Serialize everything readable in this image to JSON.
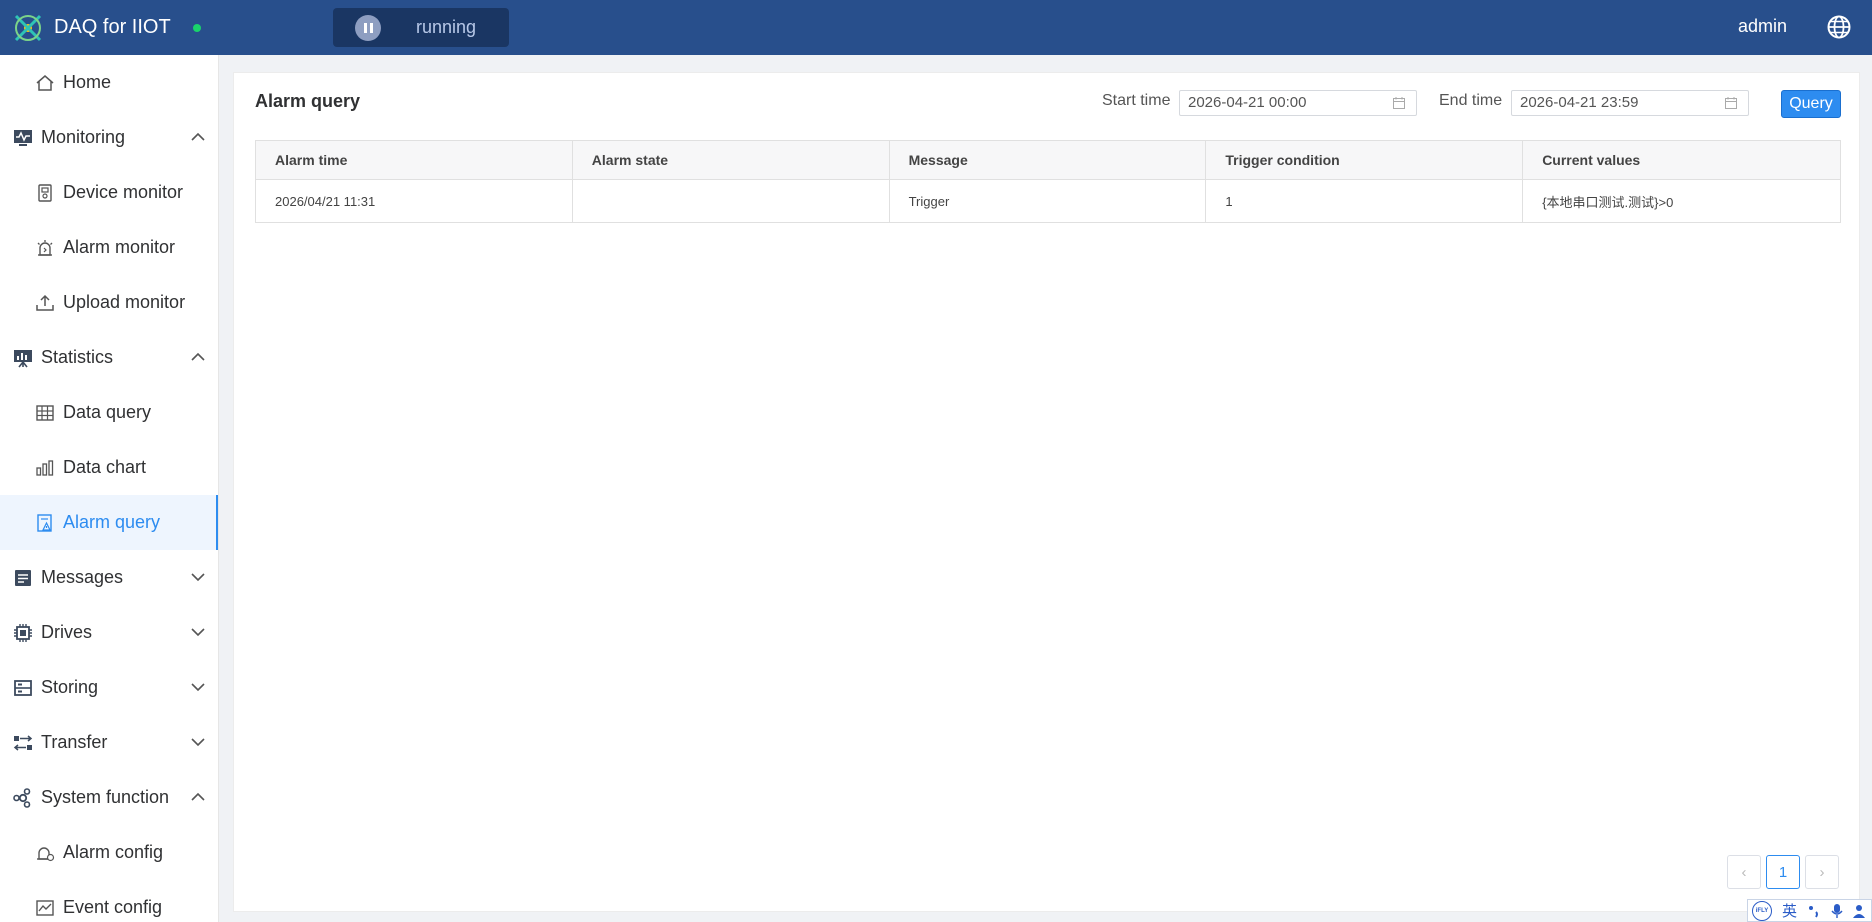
{
  "header": {
    "app_title": "DAQ for IIOT",
    "run_status": "running",
    "user": "admin"
  },
  "sidebar": {
    "items": [
      {
        "label": "Home",
        "icon": "home-icon"
      },
      {
        "label": "Monitoring",
        "icon": "monitor-icon",
        "expanded": true
      },
      {
        "label": "Device monitor",
        "icon": "device-icon"
      },
      {
        "label": "Alarm monitor",
        "icon": "alarm-icon"
      },
      {
        "label": "Upload monitor",
        "icon": "upload-icon"
      },
      {
        "label": "Statistics",
        "icon": "statistics-icon",
        "expanded": true
      },
      {
        "label": "Data query",
        "icon": "table-icon"
      },
      {
        "label": "Data chart",
        "icon": "bar-chart-icon"
      },
      {
        "label": "Alarm query",
        "icon": "alarm-query-icon",
        "active": true
      },
      {
        "label": "Messages",
        "icon": "messages-icon",
        "expanded": false
      },
      {
        "label": "Drives",
        "icon": "chip-icon",
        "expanded": false
      },
      {
        "label": "Storing",
        "icon": "storage-icon",
        "expanded": false
      },
      {
        "label": "Transfer",
        "icon": "transfer-icon",
        "expanded": false
      },
      {
        "label": "System function",
        "icon": "system-icon",
        "expanded": true
      },
      {
        "label": "Alarm config",
        "icon": "alarm-config-icon"
      },
      {
        "label": "Event config",
        "icon": "event-icon"
      }
    ]
  },
  "main": {
    "title": "Alarm query",
    "start_label": "Start time",
    "start_value": "2026-04-21 00:00",
    "end_label": "End time",
    "end_value": "2026-04-21 23:59",
    "query_label": "Query",
    "table": {
      "headers": [
        "Alarm time",
        "Alarm state",
        "Message",
        "Trigger condition",
        "Current values"
      ],
      "rows": [
        [
          "2026/04/21 11:31",
          "",
          "Trigger",
          "1",
          "{本地串口测试.测试}>0"
        ]
      ]
    },
    "pagination": {
      "current": "1",
      "prev": "‹",
      "next": "›"
    }
  },
  "ime": {
    "badge": "iFLY",
    "lang": "英"
  },
  "colors": {
    "header": "#284f8c",
    "accent": "#2d8cf0",
    "status_dot": "#19d36b"
  }
}
